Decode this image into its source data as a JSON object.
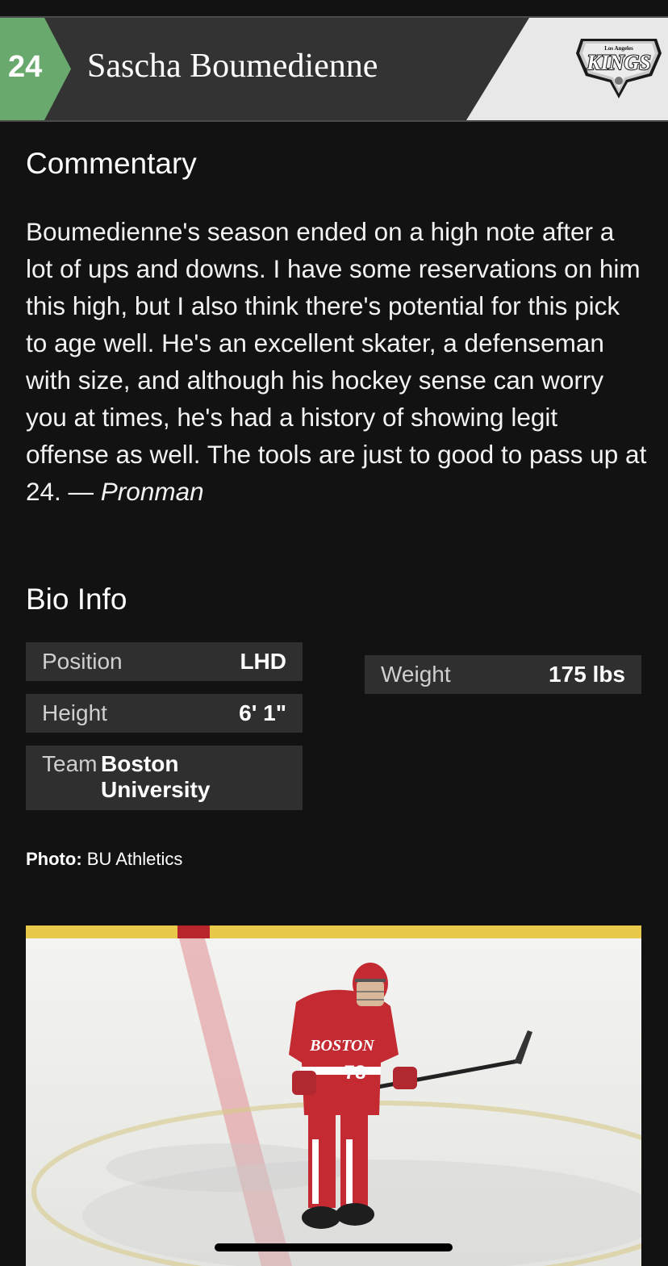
{
  "header": {
    "pick_number": "24",
    "player_name": "Sascha Boumedienne",
    "team_logo": {
      "icon": "la-kings-logo",
      "small_text": "Los Angeles",
      "main_text": "KINGS"
    },
    "accent_color": "#6aa96e"
  },
  "commentary": {
    "title": "Commentary",
    "body": "Boumedienne's season ended on a high note after a lot of ups and downs. I have some reservations on him this high, but I also think there's potential for this pick to age well. He's an excellent skater, a defenseman with size, and although his hockey sense can worry you at times, he's had a history of showing legit offense as well. The tools are just to good to pass up at 24. — ",
    "author": "Pronman"
  },
  "bio": {
    "title": "Bio Info",
    "position": {
      "label": "Position",
      "value": "LHD"
    },
    "height": {
      "label": "Height",
      "value": "6' 1\""
    },
    "weight": {
      "label": "Weight",
      "value": "175 lbs"
    },
    "team": {
      "label": "Team",
      "value_line1": "Boston",
      "value_line2": "University"
    }
  },
  "photo": {
    "credit_label": "Photo:",
    "credit_value": "BU Athletics",
    "jersey_number": "78",
    "jersey_text": "BOSTON"
  }
}
